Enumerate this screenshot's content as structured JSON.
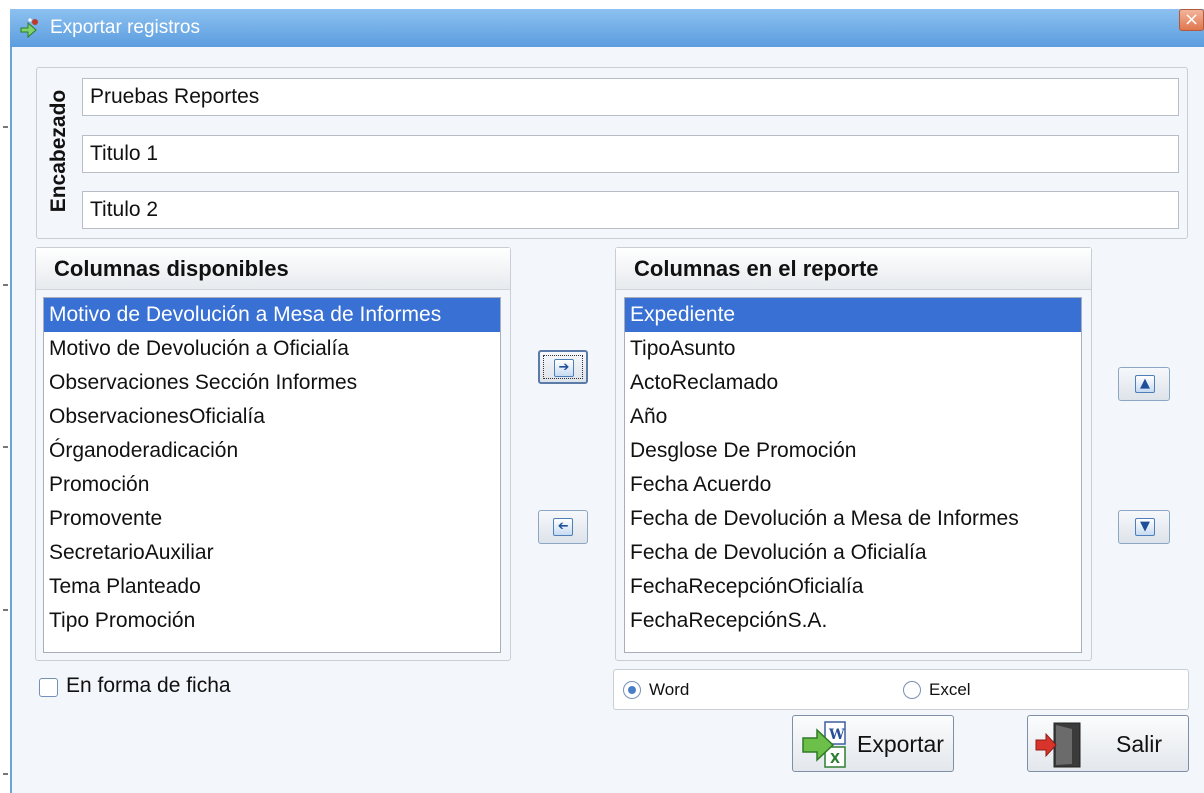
{
  "window": {
    "title": "Exportar registros",
    "close_symbol": "×"
  },
  "header_group": {
    "label": "Encabezado",
    "fields": [
      "Pruebas Reportes",
      "Titulo 1",
      "Titulo 2"
    ]
  },
  "available": {
    "title": "Columnas disponibles",
    "items": [
      "Motivo de Devolución a Mesa de Informes",
      "Motivo de Devolución a Oficialía",
      "Observaciones Sección Informes",
      "ObservacionesOficialía",
      "Órganoderadicación",
      "Promoción",
      "Promovente",
      "SecretarioAuxiliar",
      "Tema Planteado",
      "Tipo Promoción"
    ],
    "selected_index": 0
  },
  "report": {
    "title": "Columnas en el reporte",
    "items": [
      "Expediente",
      "TipoAsunto",
      "ActoReclamado",
      "Año",
      "Desglose De Promoción",
      "Fecha Acuerdo",
      "Fecha de Devolución a Mesa de Informes",
      "Fecha de Devolución a Oficialía",
      "FechaRecepciónOficialía",
      "FechaRecepciónS.A."
    ],
    "selected_index": 0
  },
  "icons": {
    "add": "arrow-right-icon",
    "remove": "arrow-left-icon",
    "up": "arrow-up-icon",
    "down": "arrow-down-icon"
  },
  "options": {
    "card_form_label": "En forma de ficha",
    "card_form_checked": false,
    "format_word": "Word",
    "format_excel": "Excel",
    "selected_format": "Word"
  },
  "buttons": {
    "export": "Exportar",
    "exit": "Salir"
  },
  "colors": {
    "titlebar": "#5c9ddf",
    "selection": "#3870d4",
    "window_bg": "#f3f6fb"
  }
}
